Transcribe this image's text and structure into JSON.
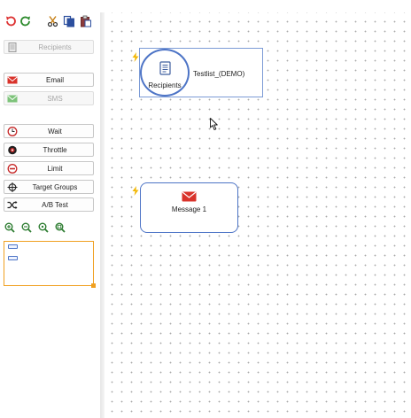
{
  "toolbar": {
    "undo_icon": "undo-icon",
    "redo_icon": "redo-icon",
    "cut_icon": "cut-icon",
    "copy_icon": "copy-icon",
    "paste_icon": "paste-icon"
  },
  "palette": {
    "recipients": "Recipients",
    "email": "Email",
    "sms": "SMS",
    "wait": "Wait",
    "throttle": "Throttle",
    "limit": "Limit",
    "target_groups": "Target Groups",
    "ab_test": "A/B Test"
  },
  "zoom": [
    "zoom-in-icon",
    "zoom-out-icon",
    "zoom-actual-icon",
    "zoom-fit-icon"
  ],
  "nodes": {
    "recipients": {
      "circle_label": "Recipients",
      "list_label": "Testlist_(DEMO)"
    },
    "message": {
      "label": "Message 1"
    }
  },
  "colors": {
    "accent_blue": "#4d74c6",
    "email_red": "#d9332b",
    "flash_yellow": "#f2b705",
    "outline_orange": "#f0a020",
    "sms_green": "#7dc37a"
  }
}
